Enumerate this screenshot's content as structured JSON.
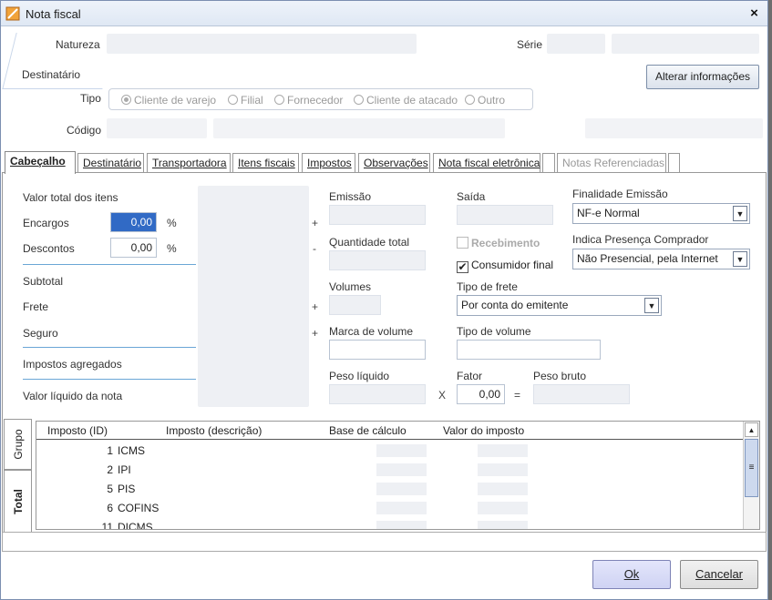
{
  "window": {
    "title": "Nota fiscal",
    "close_icon": "×"
  },
  "top": {
    "natureza_label": "Natureza",
    "serie_label": "Série",
    "destinatario_label": "Destinatário",
    "tipo_label": "Tipo",
    "codigo_label": "Código",
    "alterar_button": "Alterar informações",
    "tipo_options": [
      {
        "label": "Cliente de varejo",
        "selected": true
      },
      {
        "label": "Filial",
        "selected": false
      },
      {
        "label": "Fornecedor",
        "selected": false
      },
      {
        "label": "Cliente de atacado",
        "selected": false
      },
      {
        "label": "Outro",
        "selected": false
      }
    ]
  },
  "tabs": [
    {
      "label": "Cabeçalho",
      "active": true
    },
    {
      "label": "Destinatário"
    },
    {
      "label": "Transportadora"
    },
    {
      "label": "Itens fiscais"
    },
    {
      "label": "Impostos"
    },
    {
      "label": "Observações"
    },
    {
      "label": "Nota fiscal eletrônica"
    },
    {
      "label": ""
    },
    {
      "label": "Notas Referenciadas",
      "disabled": true
    },
    {
      "label": ""
    }
  ],
  "totals": {
    "valor_total_itens": "Valor total dos itens",
    "encargos": "Encargos",
    "encargos_value": "0,00",
    "descontos": "Descontos",
    "descontos_value": "0,00",
    "percent": "%",
    "subtotal": "Subtotal",
    "frete": "Frete",
    "seguro": "Seguro",
    "impostos_agregados": "Impostos agregados",
    "valor_liquido": "Valor líquido da nota",
    "plus": "+",
    "minus": "-"
  },
  "middle": {
    "emissao": "Emissão",
    "quantidade_total": "Quantidade total",
    "volumes": "Volumes",
    "marca_volume": "Marca de volume",
    "peso_liquido": "Peso líquido",
    "times": "X",
    "equals": "="
  },
  "right": {
    "saida": "Saída",
    "recebimento": "Recebimento",
    "consumidor_final": "Consumidor final",
    "consumidor_final_checked": "✔",
    "tipo_frete_label": "Tipo de frete",
    "tipo_frete_value": "Por conta do emitente",
    "tipo_volume_label": "Tipo de volume",
    "fator_label": "Fator",
    "fator_value": "0,00",
    "peso_bruto_label": "Peso bruto",
    "finalidade_label": "Finalidade Emissão",
    "finalidade_value": "NF-e Normal",
    "presenca_label": "Indica Presença Comprador",
    "presenca_value": "Não Presencial, pela Internet"
  },
  "side_tabs": {
    "grupo": "Grupo",
    "total": "Total"
  },
  "grid": {
    "headers": [
      "Imposto (ID)",
      "Imposto (descrição)",
      "Base de cálculo",
      "Valor do imposto"
    ],
    "rows": [
      {
        "id": "1",
        "desc": "ICMS"
      },
      {
        "id": "2",
        "desc": "IPI"
      },
      {
        "id": "5",
        "desc": "PIS"
      },
      {
        "id": "6",
        "desc": "COFINS"
      },
      {
        "id": "11",
        "desc": "DICMS"
      }
    ]
  },
  "buttons": {
    "ok": "Ok",
    "cancel": "Cancelar"
  },
  "colors": {
    "accent": "#316ac5",
    "separator": "#6aa6d6",
    "window_border": "#7b8fb0"
  }
}
